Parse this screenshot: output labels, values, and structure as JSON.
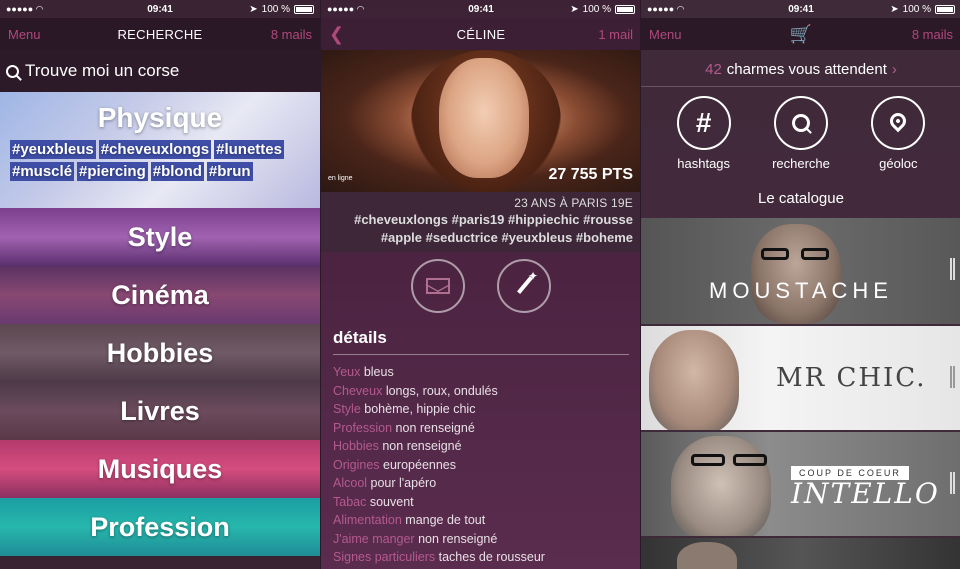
{
  "status": {
    "time": "09:41",
    "battery": "100 %"
  },
  "panel1": {
    "nav": {
      "left": "Menu",
      "title": "RECHERCHE",
      "right": "8 mails"
    },
    "search": {
      "text": "Trouve moi un corse"
    },
    "categories": [
      {
        "label": "Physique",
        "tags": [
          "#yeuxbleus",
          "#cheveuxlongs",
          "#lunettes",
          "#musclé",
          "#piercing",
          "#blond",
          "#brun"
        ]
      },
      {
        "label": "Style"
      },
      {
        "label": "Cinéma"
      },
      {
        "label": "Hobbies"
      },
      {
        "label": "Livres"
      },
      {
        "label": "Musiques"
      },
      {
        "label": "Profession"
      }
    ]
  },
  "panel2": {
    "nav": {
      "title": "CÉLINE",
      "right": "1 mail"
    },
    "online": "en ligne",
    "points": "27 755 PTS",
    "agecity": "23 ANS À PARIS 19E",
    "tags_line1": "#cheveuxlongs #paris19 #hippiechic #rousse",
    "tags_line2": "#apple #seductrice #yeuxbleus #boheme",
    "details_title": "détails",
    "details": [
      {
        "k": "Yeux",
        "v": "bleus"
      },
      {
        "k": "Cheveux",
        "v": "longs, roux, ondulés"
      },
      {
        "k": "Style",
        "v": "bohème, hippie chic"
      },
      {
        "k": "Profession",
        "v": "non renseigné"
      },
      {
        "k": "Hobbies",
        "v": "non renseigné"
      },
      {
        "k": "Origines",
        "v": "européennes"
      },
      {
        "k": "Alcool",
        "v": "pour l'apéro"
      },
      {
        "k": "Tabac",
        "v": "souvent"
      },
      {
        "k": "Alimentation",
        "v": "mange de tout"
      },
      {
        "k": "J'aime manger",
        "v": "non renseigné"
      },
      {
        "k": "Signes particuliers",
        "v": "taches de rousseur"
      }
    ]
  },
  "panel3": {
    "nav": {
      "left": "Menu",
      "right": "8 mails"
    },
    "charmes_count": "42",
    "charmes_text": "charmes vous attendent",
    "buttons": [
      {
        "label": "hashtags",
        "icon": "hashtag-icon"
      },
      {
        "label": "recherche",
        "icon": "search-icon"
      },
      {
        "label": "géoloc",
        "icon": "location-pin-icon"
      }
    ],
    "catalog_title": "Le catalogue",
    "banners": [
      {
        "title": "MOUSTACHE"
      },
      {
        "title": "MR CHIC."
      },
      {
        "title": "INTELLO",
        "badge": "COUP DE COEUR"
      }
    ]
  },
  "colors": {
    "accent": "#b0487d",
    "tag_bg": "#3f4fa8"
  }
}
